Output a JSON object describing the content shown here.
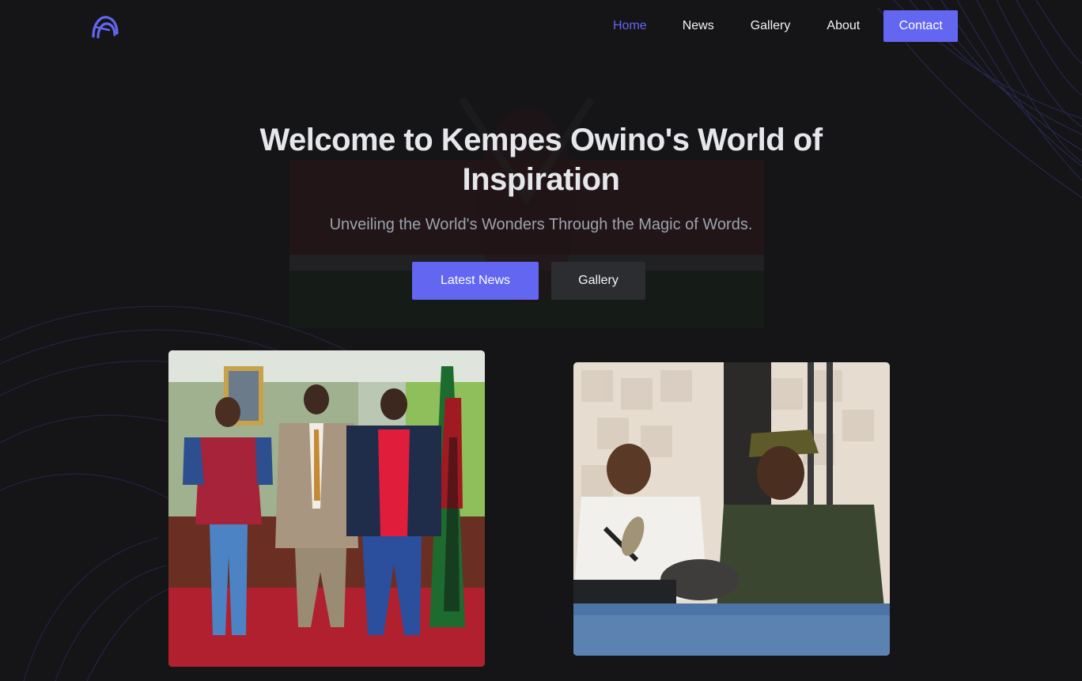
{
  "nav": {
    "logo_icon": "brand-arc-logo",
    "items": [
      {
        "label": "Home",
        "active": true
      },
      {
        "label": "News",
        "active": false
      },
      {
        "label": "Gallery",
        "active": false
      },
      {
        "label": "About",
        "active": false
      }
    ],
    "contact_label": "Contact"
  },
  "hero": {
    "title": "Welcome to Kempes Owino's World of Inspiration",
    "subtitle": "Unveiling the World's Wonders Through the Magic of Words.",
    "primary_button": "Latest News",
    "secondary_button": "Gallery"
  },
  "photos": [
    {
      "subject": "three men standing in an office with flags"
    },
    {
      "subject": "two men at a radio studio microphone"
    }
  ],
  "colors": {
    "accent": "#6366f1",
    "background": "#151517",
    "secondary_button": "#2c2d31"
  }
}
